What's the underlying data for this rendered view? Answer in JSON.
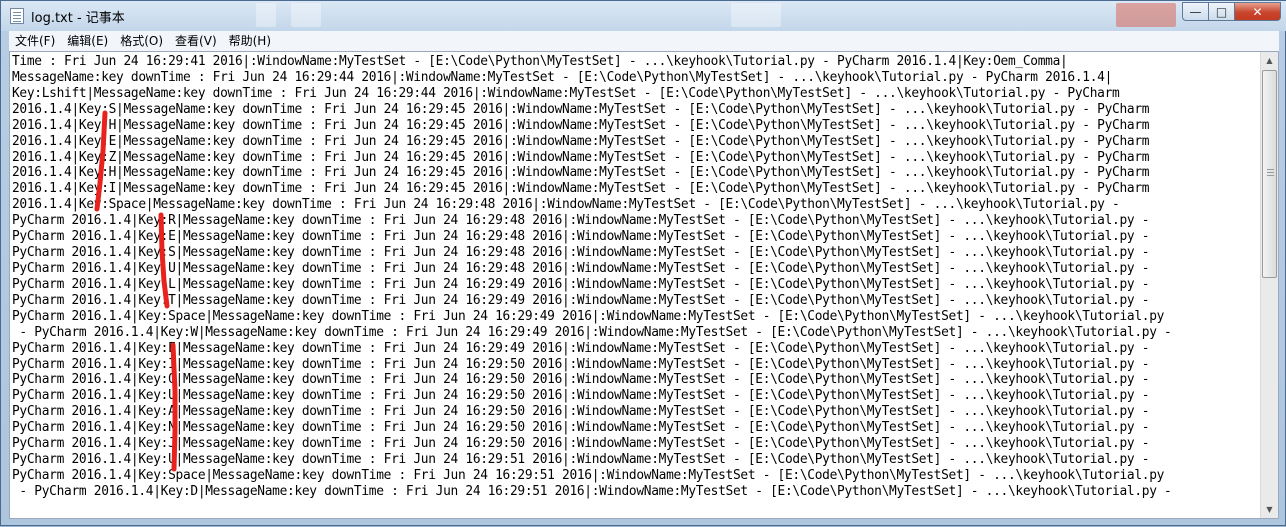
{
  "window": {
    "title": "log.txt - 记事本",
    "close_glyph": "✕",
    "max_glyph": "□",
    "min_glyph": "—"
  },
  "menu": {
    "items": [
      "文件(F)",
      "编辑(E)",
      "格式(O)",
      "查看(V)",
      "帮助(H)"
    ]
  },
  "editor": {
    "lines": [
      "Time : Fri Jun 24 16:29:41 2016|:WindowName:MyTestSet - [E:\\Code\\Python\\MyTestSet] - ...\\keyhook\\Tutorial.py - PyCharm 2016.1.4|Key:Oem_Comma|",
      "MessageName:key downTime : Fri Jun 24 16:29:44 2016|:WindowName:MyTestSet - [E:\\Code\\Python\\MyTestSet] - ...\\keyhook\\Tutorial.py - PyCharm 2016.1.4|",
      "Key:Lshift|MessageName:key downTime : Fri Jun 24 16:29:44 2016|:WindowName:MyTestSet - [E:\\Code\\Python\\MyTestSet] - ...\\keyhook\\Tutorial.py - PyCharm",
      "2016.1.4|Key:S|MessageName:key downTime : Fri Jun 24 16:29:45 2016|:WindowName:MyTestSet - [E:\\Code\\Python\\MyTestSet] - ...\\keyhook\\Tutorial.py - PyCharm",
      "2016.1.4|Key:H|MessageName:key downTime : Fri Jun 24 16:29:45 2016|:WindowName:MyTestSet - [E:\\Code\\Python\\MyTestSet] - ...\\keyhook\\Tutorial.py - PyCharm",
      "2016.1.4|Key:E|MessageName:key downTime : Fri Jun 24 16:29:45 2016|:WindowName:MyTestSet - [E:\\Code\\Python\\MyTestSet] - ...\\keyhook\\Tutorial.py - PyCharm",
      "2016.1.4|Key:Z|MessageName:key downTime : Fri Jun 24 16:29:45 2016|:WindowName:MyTestSet - [E:\\Code\\Python\\MyTestSet] - ...\\keyhook\\Tutorial.py - PyCharm",
      "2016.1.4|Key:H|MessageName:key downTime : Fri Jun 24 16:29:45 2016|:WindowName:MyTestSet - [E:\\Code\\Python\\MyTestSet] - ...\\keyhook\\Tutorial.py - PyCharm",
      "2016.1.4|Key:I|MessageName:key downTime : Fri Jun 24 16:29:45 2016|:WindowName:MyTestSet - [E:\\Code\\Python\\MyTestSet] - ...\\keyhook\\Tutorial.py - PyCharm",
      "2016.1.4|Key:Space|MessageName:key downTime : Fri Jun 24 16:29:48 2016|:WindowName:MyTestSet - [E:\\Code\\Python\\MyTestSet] - ...\\keyhook\\Tutorial.py -",
      "PyCharm 2016.1.4|Key:R|MessageName:key downTime : Fri Jun 24 16:29:48 2016|:WindowName:MyTestSet - [E:\\Code\\Python\\MyTestSet] - ...\\keyhook\\Tutorial.py -",
      "PyCharm 2016.1.4|Key:E|MessageName:key downTime : Fri Jun 24 16:29:48 2016|:WindowName:MyTestSet - [E:\\Code\\Python\\MyTestSet] - ...\\keyhook\\Tutorial.py -",
      "PyCharm 2016.1.4|Key:S|MessageName:key downTime : Fri Jun 24 16:29:48 2016|:WindowName:MyTestSet - [E:\\Code\\Python\\MyTestSet] - ...\\keyhook\\Tutorial.py -",
      "PyCharm 2016.1.4|Key:U|MessageName:key downTime : Fri Jun 24 16:29:48 2016|:WindowName:MyTestSet - [E:\\Code\\Python\\MyTestSet] - ...\\keyhook\\Tutorial.py -",
      "PyCharm 2016.1.4|Key:L|MessageName:key downTime : Fri Jun 24 16:29:49 2016|:WindowName:MyTestSet - [E:\\Code\\Python\\MyTestSet] - ...\\keyhook\\Tutorial.py -",
      "PyCharm 2016.1.4|Key:T|MessageName:key downTime : Fri Jun 24 16:29:49 2016|:WindowName:MyTestSet - [E:\\Code\\Python\\MyTestSet] - ...\\keyhook\\Tutorial.py -",
      "PyCharm 2016.1.4|Key:Space|MessageName:key downTime : Fri Jun 24 16:29:49 2016|:WindowName:MyTestSet - [E:\\Code\\Python\\MyTestSet] - ...\\keyhook\\Tutorial.py",
      " - PyCharm 2016.1.4|Key:W|MessageName:key downTime : Fri Jun 24 16:29:49 2016|:WindowName:MyTestSet - [E:\\Code\\Python\\MyTestSet] - ...\\keyhook\\Tutorial.py -",
      "PyCharm 2016.1.4|Key:E|MessageName:key downTime : Fri Jun 24 16:29:49 2016|:WindowName:MyTestSet - [E:\\Code\\Python\\MyTestSet] - ...\\keyhook\\Tutorial.py -",
      "PyCharm 2016.1.4|Key:I|MessageName:key downTime : Fri Jun 24 16:29:50 2016|:WindowName:MyTestSet - [E:\\Code\\Python\\MyTestSet] - ...\\keyhook\\Tutorial.py -",
      "PyCharm 2016.1.4|Key:Q|MessageName:key downTime : Fri Jun 24 16:29:50 2016|:WindowName:MyTestSet - [E:\\Code\\Python\\MyTestSet] - ...\\keyhook\\Tutorial.py -",
      "PyCharm 2016.1.4|Key:U|MessageName:key downTime : Fri Jun 24 16:29:50 2016|:WindowName:MyTestSet - [E:\\Code\\Python\\MyTestSet] - ...\\keyhook\\Tutorial.py -",
      "PyCharm 2016.1.4|Key:A|MessageName:key downTime : Fri Jun 24 16:29:50 2016|:WindowName:MyTestSet - [E:\\Code\\Python\\MyTestSet] - ...\\keyhook\\Tutorial.py -",
      "PyCharm 2016.1.4|Key:N|MessageName:key downTime : Fri Jun 24 16:29:50 2016|:WindowName:MyTestSet - [E:\\Code\\Python\\MyTestSet] - ...\\keyhook\\Tutorial.py -",
      "PyCharm 2016.1.4|Key:J|MessageName:key downTime : Fri Jun 24 16:29:50 2016|:WindowName:MyTestSet - [E:\\Code\\Python\\MyTestSet] - ...\\keyhook\\Tutorial.py -",
      "PyCharm 2016.1.4|Key:U|MessageName:key downTime : Fri Jun 24 16:29:51 2016|:WindowName:MyTestSet - [E:\\Code\\Python\\MyTestSet] - ...\\keyhook\\Tutorial.py -",
      "PyCharm 2016.1.4|Key:Space|MessageName:key downTime : Fri Jun 24 16:29:51 2016|:WindowName:MyTestSet - [E:\\Code\\Python\\MyTestSet] - ...\\keyhook\\Tutorial.py",
      " - PyCharm 2016.1.4|Key:D|MessageName:key downTime : Fri Jun 24 16:29:51 2016|:WindowName:MyTestSet - [E:\\Code\\Python\\MyTestSet] - ...\\keyhook\\Tutorial.py -"
    ]
  },
  "colors": {
    "annotation_red": "#e8231e",
    "close_red": "#c9462e"
  },
  "scrollbar": {
    "up_glyph": "▲",
    "down_glyph": "▼"
  }
}
